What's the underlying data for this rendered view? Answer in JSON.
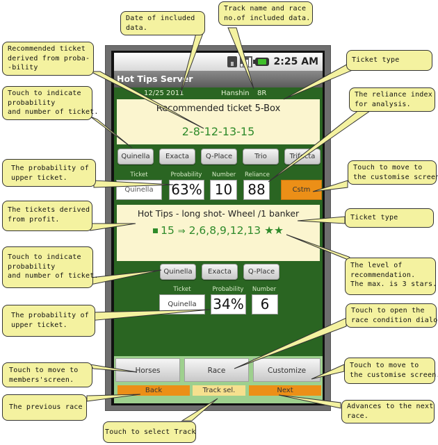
{
  "status_bar": {
    "network_icon": "3g-icon",
    "signal_icon": "signal-bars-icon",
    "battery_icon": "battery-charging-icon",
    "time": "2:25 AM"
  },
  "app": {
    "title": "Hot Tips Server"
  },
  "info_bar": {
    "date": "12/25 2011",
    "track": "Hanshin",
    "race": "8R"
  },
  "recommended": {
    "title": "Recommended ticket  5-Box",
    "combination": "2-8-12-13-15",
    "ticket_buttons": [
      "Quinella",
      "Exacta",
      "Q-Place",
      "Trio",
      "Trifecta"
    ],
    "labels": {
      "ticket": "Ticket",
      "probability": "Probability",
      "number": "Number",
      "reliance": "Reliance"
    },
    "values": {
      "ticket": "Quinella",
      "probability": "63%",
      "number": "10",
      "reliance": "88"
    },
    "customize_button": "Cstm"
  },
  "hot_tips": {
    "title": "Hot Tips  - long shot-   Wheel /1 banker",
    "banker_icon": "square-bullet-icon",
    "banker": "15",
    "arrow": "⇒",
    "partners": "2,6,8,9,12,13",
    "stars": "★★",
    "star_rating": 2,
    "star_max": 3,
    "ticket_buttons": [
      "Quinella",
      "Exacta",
      "Q-Place"
    ],
    "labels": {
      "ticket": "Ticket",
      "probability": "Probability",
      "number": "Number"
    },
    "values": {
      "ticket": "Quinella",
      "probability": "34%",
      "number": "6"
    }
  },
  "bottom": {
    "buttons": [
      "Horses",
      "Race",
      "Customize"
    ],
    "nav": {
      "back": "Back",
      "track": "Track sel.",
      "next": "Next"
    }
  },
  "callouts": {
    "date": "Date of included\ndata.",
    "track": "Track name and race\nno.of included data.",
    "recommended": "Recommended ticket\nderived from proba-\n-bility",
    "ticket_type_1": "Ticket type",
    "touch_indicate_1": "Touch to indicate\nprobability\nand number of ticket.",
    "reliance": "The reliance index\nfor analysis.",
    "probability_1": "The probability of\nupper ticket.",
    "customise_1": "Touch to move to\nthe customise screen.",
    "profit": "The tickets derived\nfrom profit.",
    "ticket_type_2": "Ticket type",
    "touch_indicate_2": "Touch to indicate\nprobability\nand number of ticket.",
    "level": "The level of\nrecommendation.\nThe max. is 3 stars.",
    "probability_2": "The probability of\nupper ticket.",
    "race_dialog": "Touch to open the\nrace condition dialog.",
    "members": "Touch to move to\nmembers'screen.",
    "customise_2": "Touch to move to\nthe customise screen.",
    "previous": "The previous race",
    "next_race": "Advances to the next\nrace.",
    "track_select": "Touch to select Track"
  }
}
